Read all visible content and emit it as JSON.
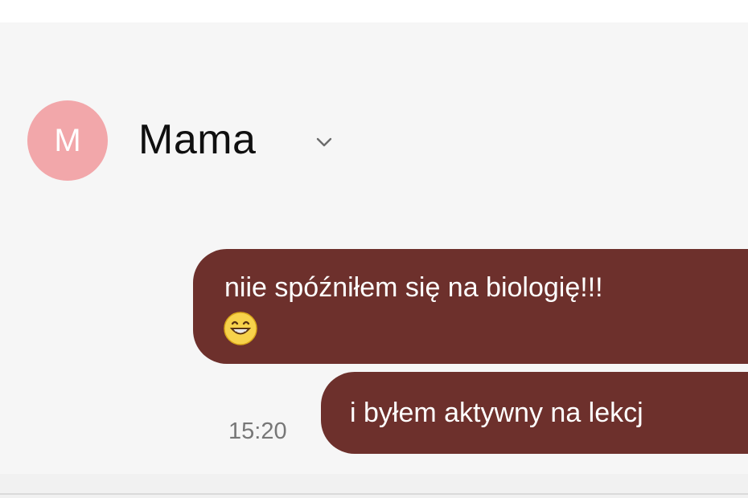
{
  "header": {
    "avatar_letter": "M",
    "contact_name": "Mama"
  },
  "messages": [
    {
      "text": "niie spóźniłem się na biologię!!!",
      "emoji": "grinning-face-with-smiling-eyes"
    },
    {
      "text": "i byłem aktywny na lekcj"
    }
  ],
  "timestamp": "15:20",
  "colors": {
    "background": "#f6f6f6",
    "avatar": "#f2a7aa",
    "bubble": "#6d302c",
    "timestamp": "#777777"
  }
}
